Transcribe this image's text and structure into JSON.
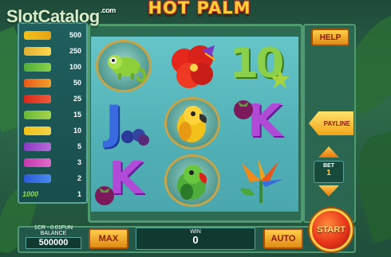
{
  "watermark": {
    "text": "SlotCatalog",
    "suffix": ".com"
  },
  "game": {
    "title": "HOT PALM"
  },
  "paytable": {
    "values": [
      "500",
      "250",
      "100",
      "50",
      "25",
      "15",
      "10",
      "5",
      "3",
      "2",
      "1"
    ],
    "last_icon_text": "1000"
  },
  "reels": {
    "col1": [
      {
        "icon": "chameleon"
      },
      {
        "icon": "letter-j",
        "text": "J"
      },
      {
        "icon": "letter-k",
        "text": "K"
      }
    ],
    "col2": [
      {
        "icon": "hibiscus-flower"
      },
      {
        "icon": "yellow-parrot"
      },
      {
        "icon": "green-parrot"
      }
    ],
    "col3": [
      {
        "icon": "number-10",
        "text": "10"
      },
      {
        "icon": "letter-k",
        "text": "K"
      },
      {
        "icon": "bird-of-paradise-flower"
      }
    ]
  },
  "controls": {
    "help_label": "HELP",
    "payline_label": "PAYLINE",
    "bet_label": "BET",
    "bet_value": "1",
    "max_label": "MAX",
    "auto_label": "AUTO",
    "start_label": "START"
  },
  "status": {
    "coin_range": "1CR - 0.01FUN",
    "balance_label": "BALANCE",
    "balance_value": "500000",
    "win_label": "WIN",
    "win_value": "0"
  },
  "colors": {
    "reel_background": "#50b0b5",
    "button_orange": "#e08a14",
    "title_yellow": "#ffcf3a"
  }
}
